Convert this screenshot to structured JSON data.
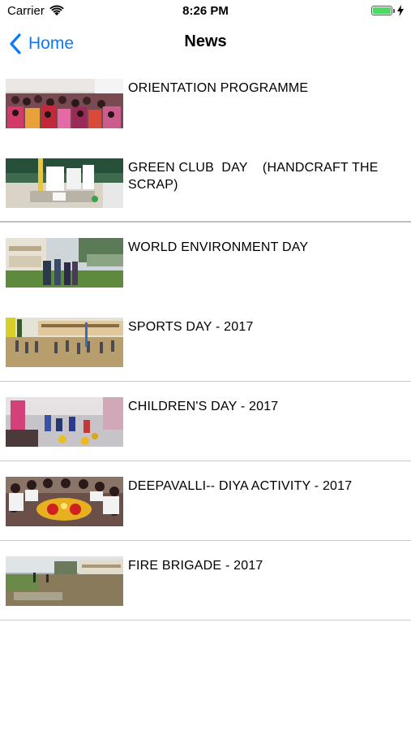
{
  "status_bar": {
    "carrier": "Carrier",
    "time": "8:26 PM",
    "battery_level": 1.0
  },
  "nav": {
    "back_label": "Home",
    "title": "News"
  },
  "colors": {
    "accent": "#0a7aff",
    "separator": "#c8c8c8",
    "battery": "#4cd964"
  },
  "news": [
    {
      "title": "ORIENTATION PROGRAMME",
      "thumb": "crowd-photo"
    },
    {
      "title": "GREEN CLUB  DAY    (HANDCRAFT THE SCRAP)",
      "thumb": "craft-table-photo"
    },
    {
      "title": "WORLD ENVIRONMENT DAY",
      "thumb": "school-garden-photo"
    },
    {
      "title": "SPORTS DAY - 2017",
      "thumb": "sports-ground-photo"
    },
    {
      "title": "CHILDREN'S DAY - 2017",
      "thumb": "children-games-photo"
    },
    {
      "title": "DEEPAVALLI-- DIYA ACTIVITY - 2017",
      "thumb": "diya-circle-photo"
    },
    {
      "title": "FIRE BRIGADE - 2017",
      "thumb": "fire-brigade-photo"
    }
  ]
}
